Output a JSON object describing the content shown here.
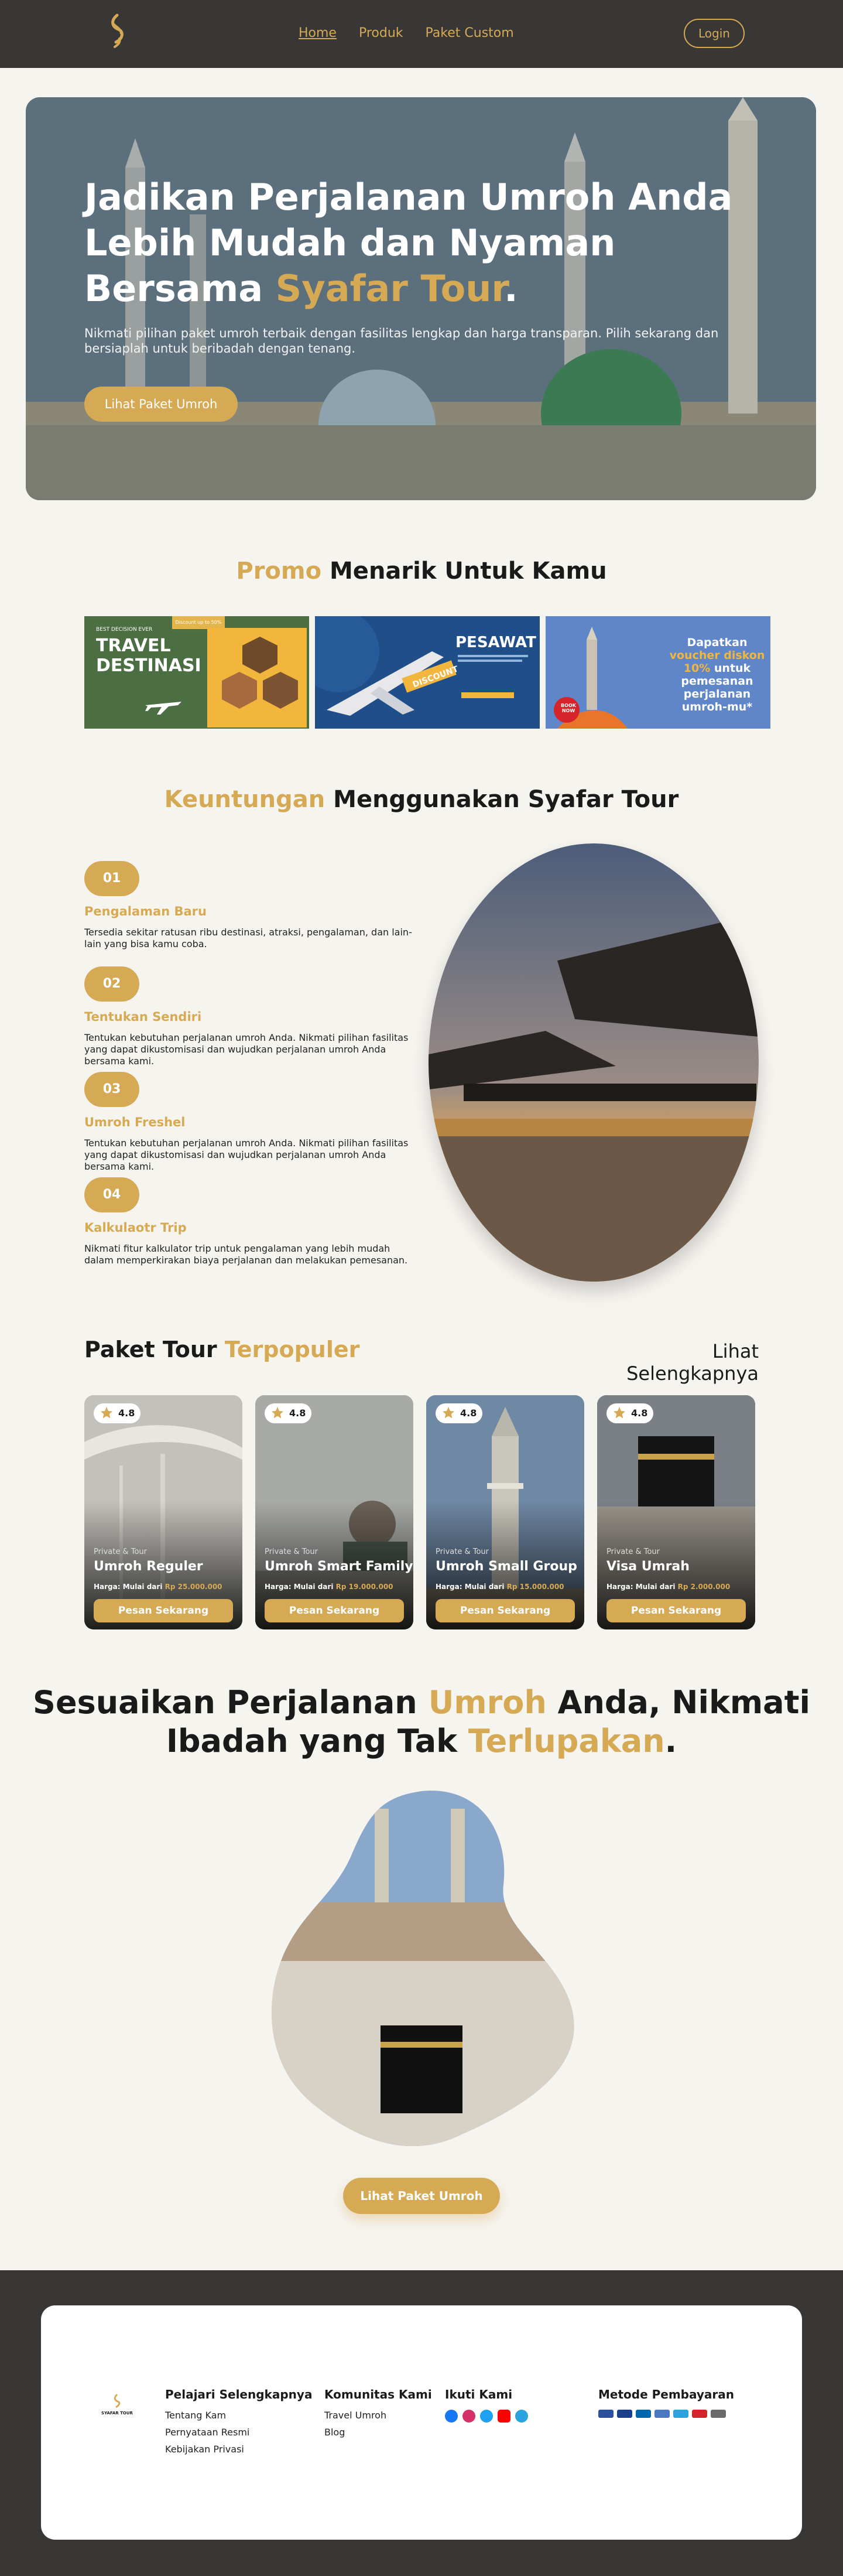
{
  "nav": {
    "links": [
      "Home",
      "Produk",
      "Paket Custom"
    ],
    "active_link": "Home",
    "login_label": "Login"
  },
  "hero": {
    "title_line1": "Jadikan Perjalanan Umroh Anda",
    "title_line2": "Lebih Mudah dan Nyaman",
    "title_line3_prefix": "Bersama ",
    "title_brand": "Syafar Tour",
    "title_suffix": ".",
    "subtitle": "Nikmati pilihan paket umroh terbaik dengan fasilitas lengkap dan harga transparan. Pilih sekarang dan bersiaplah untuk beribadah dengan tenang.",
    "cta_label": "Lihat Paket Umroh"
  },
  "promo": {
    "title_highlight": "Promo",
    "title_rest": " Menarik Untuk Kamu",
    "banners": [
      {
        "heading": "TRAVEL",
        "heading2": "DESTINASI",
        "tag": "BEST DECISION EVER",
        "badge": "Discount up to 50%"
      },
      {
        "heading": "PESAWAT",
        "badge": "DISCOUNT"
      },
      {
        "heading": "Dapatkan",
        "highlight": "voucher diskon 10%",
        "rest": "untuk pemesanan perjalanan umroh-mu*",
        "badge": "BOOK NOW"
      }
    ]
  },
  "benefits": {
    "title_highlight": "Keuntungan",
    "title_rest": " Menggunakan Syafar Tour",
    "items": [
      {
        "num": "01",
        "title": "Pengalaman Baru",
        "desc": "Tersedia sekitar ratusan ribu destinasi, atraksi, pengalaman, dan lain-lain yang bisa kamu coba."
      },
      {
        "num": "02",
        "title": "Tentukan Sendiri",
        "desc": "Tentukan kebutuhan perjalanan umroh Anda. Nikmati pilihan fasilitas yang dapat dikustomisasi dan wujudkan perjalanan umroh Anda bersama kami."
      },
      {
        "num": "03",
        "title": "Umroh Freshel",
        "desc": "Tentukan kebutuhan perjalanan umroh Anda. Nikmati pilihan fasilitas yang dapat dikustomisasi dan wujudkan perjalanan umroh Anda bersama kami."
      },
      {
        "num": "04",
        "title": "Kalkulaotr Trip",
        "desc": "Nikmati fitur kalkulator trip untuk pengalaman yang lebih mudah dalam memperkirakan biaya perjalanan dan melakukan pemesanan."
      }
    ]
  },
  "packages": {
    "title_prefix": "Paket Tour ",
    "title_highlight": "Terpopuler",
    "see_more": "Lihat Selengkapnya",
    "items": [
      {
        "rating": "4.8",
        "kind": "Private & Tour",
        "name": "Umroh Reguler",
        "price_label": "Harga: Mulai dari ",
        "price": "Rp 25.000.000",
        "button": "Pesan Sekarang",
        "bg": "#b9b4aa"
      },
      {
        "rating": "4.8",
        "kind": "Private & Tour",
        "name": "Umroh Smart Family",
        "price_label": "Harga: Mulai dari ",
        "price": "Rp 19.000.000",
        "button": "Pesan Sekarang",
        "bg": "#9fa1a0"
      },
      {
        "rating": "4.8",
        "kind": "Private & Tour",
        "name": "Umroh Small Group",
        "price_label": "Harga: Mulai dari ",
        "price": "Rp 15.000.000",
        "button": "Pesan Sekarang",
        "bg": "#7e93a8"
      },
      {
        "rating": "4.8",
        "kind": "Private & Tour",
        "name": "Visa Umrah",
        "price_label": "Harga: Mulai dari ",
        "price": "Rp 2.000.000",
        "button": "Pesan Sekarang",
        "bg": "#6a6f78"
      }
    ]
  },
  "custom": {
    "line1_a": "Sesuaikan Perjalanan ",
    "line1_b": "Umroh",
    "line1_c": " Anda, Nikmati",
    "line2_a": "Ibadah yang Tak ",
    "line2_b": "Terlupakan",
    "line2_c": ".",
    "cta_label": "Lihat Paket Umroh"
  },
  "footer": {
    "brand_name": "SYAFAR TOUR",
    "learn_title": "Pelajari Selengkapnya",
    "learn_items": [
      "Tentang Kam",
      "Pernyataan Resmi",
      "Kebijakan Privasi"
    ],
    "community_title": "Komunitas Kami",
    "community_items": [
      "Travel Umroh",
      "Blog"
    ],
    "follow_title": "Ikuti Kami",
    "socials": [
      "facebook-icon",
      "instagram-icon",
      "twitter-icon",
      "youtube-icon",
      "telegram-icon"
    ],
    "payment_title": "Metode Pembayaran"
  },
  "colors": {
    "accent": "#d6aa55",
    "dark": "#383735",
    "background": "#f6f4ef"
  }
}
